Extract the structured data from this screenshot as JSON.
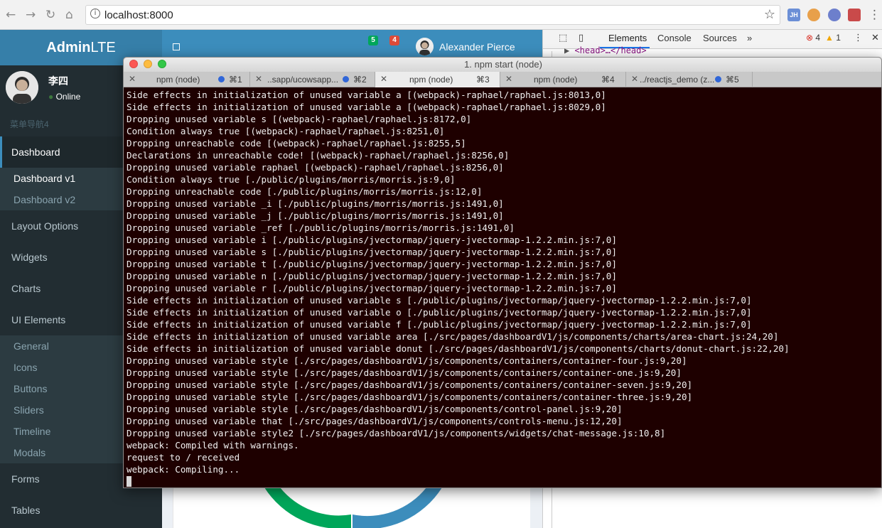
{
  "browser": {
    "url": "localhost:8000",
    "ext_jh": "JH"
  },
  "sidebar": {
    "logo_bold": "Admin",
    "logo_rest": "LTE",
    "user_name": "李四",
    "user_status": "Online",
    "menu_header": "菜单导航4",
    "items": [
      {
        "label": "Dashboard"
      },
      {
        "label": "Layout Options"
      },
      {
        "label": "Widgets"
      },
      {
        "label": "Charts"
      },
      {
        "label": "UI Elements"
      },
      {
        "label": "Forms"
      },
      {
        "label": "Tables"
      }
    ],
    "dashboard_sub": [
      "Dashboard v1",
      "Dashboard v2"
    ],
    "ui_sub": [
      "General",
      "Icons",
      "Buttons",
      "Sliders",
      "Timeline",
      "Modals"
    ]
  },
  "header": {
    "badge_green": "5",
    "badge_red": "4",
    "user_name": "Alexander Pierce"
  },
  "devtools": {
    "tabs": [
      "Elements",
      "Console",
      "Sources"
    ],
    "more": "»",
    "errors": "4",
    "warnings": "1",
    "head_node": "<head>…</head>"
  },
  "terminal": {
    "title": "1. npm start (node)",
    "tabs": [
      {
        "label": "npm (node)",
        "key": "⌘1"
      },
      {
        "label": "..sapp/ucowsapp...",
        "key": "⌘2"
      },
      {
        "label": "npm (node)",
        "key": "⌘3"
      },
      {
        "label": "npm (node)",
        "key": "⌘4"
      },
      {
        "label": "../reactjs_demo (z...",
        "key": "⌘5"
      }
    ],
    "lines": [
      "Side effects in initialization of unused variable a [(webpack)-raphael/raphael.js:8013,0]",
      "Side effects in initialization of unused variable a [(webpack)-raphael/raphael.js:8029,0]",
      "Dropping unused variable s [(webpack)-raphael/raphael.js:8172,0]",
      "Condition always true [(webpack)-raphael/raphael.js:8251,0]",
      "Dropping unreachable code [(webpack)-raphael/raphael.js:8255,5]",
      "Declarations in unreachable code! [(webpack)-raphael/raphael.js:8256,0]",
      "Dropping unused variable raphael [(webpack)-raphael/raphael.js:8256,0]",
      "Condition always true [./public/plugins/morris/morris.js:9,0]",
      "Dropping unreachable code [./public/plugins/morris/morris.js:12,0]",
      "Dropping unused variable _i [./public/plugins/morris/morris.js:1491,0]",
      "Dropping unused variable _j [./public/plugins/morris/morris.js:1491,0]",
      "Dropping unused variable _ref [./public/plugins/morris/morris.js:1491,0]",
      "Dropping unused variable i [./public/plugins/jvectormap/jquery-jvectormap-1.2.2.min.js:7,0]",
      "Dropping unused variable s [./public/plugins/jvectormap/jquery-jvectormap-1.2.2.min.js:7,0]",
      "Dropping unused variable t [./public/plugins/jvectormap/jquery-jvectormap-1.2.2.min.js:7,0]",
      "Dropping unused variable n [./public/plugins/jvectormap/jquery-jvectormap-1.2.2.min.js:7,0]",
      "Dropping unused variable r [./public/plugins/jvectormap/jquery-jvectormap-1.2.2.min.js:7,0]",
      "Side effects in initialization of unused variable s [./public/plugins/jvectormap/jquery-jvectormap-1.2.2.min.js:7,0]",
      "Side effects in initialization of unused variable o [./public/plugins/jvectormap/jquery-jvectormap-1.2.2.min.js:7,0]",
      "Side effects in initialization of unused variable f [./public/plugins/jvectormap/jquery-jvectormap-1.2.2.min.js:7,0]",
      "Side effects in initialization of unused variable area [./src/pages/dashboardV1/js/components/charts/area-chart.js:24,20]",
      "Side effects in initialization of unused variable donut [./src/pages/dashboardV1/js/components/charts/donut-chart.js:22,20]",
      "Dropping unused variable style [./src/pages/dashboardV1/js/components/containers/container-four.js:9,20]",
      "Dropping unused variable style [./src/pages/dashboardV1/js/components/containers/container-one.js:9,20]",
      "Dropping unused variable style [./src/pages/dashboardV1/js/components/containers/container-seven.js:9,20]",
      "Dropping unused variable style [./src/pages/dashboardV1/js/components/containers/container-three.js:9,20]",
      "Dropping unused variable style [./src/pages/dashboardV1/js/components/control-panel.js:9,20]",
      "Dropping unused variable that [./src/pages/dashboardV1/js/components/controls-menu.js:12,20]",
      "Dropping unused variable style2 [./src/pages/dashboardV1/js/components/widgets/chat-message.js:10,8]",
      "webpack: Compiled with warnings.",
      "request to / received",
      "webpack: Compiling..."
    ]
  },
  "colors": {
    "sidebar_bg": "#222d32",
    "header_blue": "#3c8dbc",
    "logo_blue": "#367fa9",
    "terminal_bg": "#1e0000",
    "badge_green": "#00a65a",
    "badge_red": "#dd4b39"
  }
}
